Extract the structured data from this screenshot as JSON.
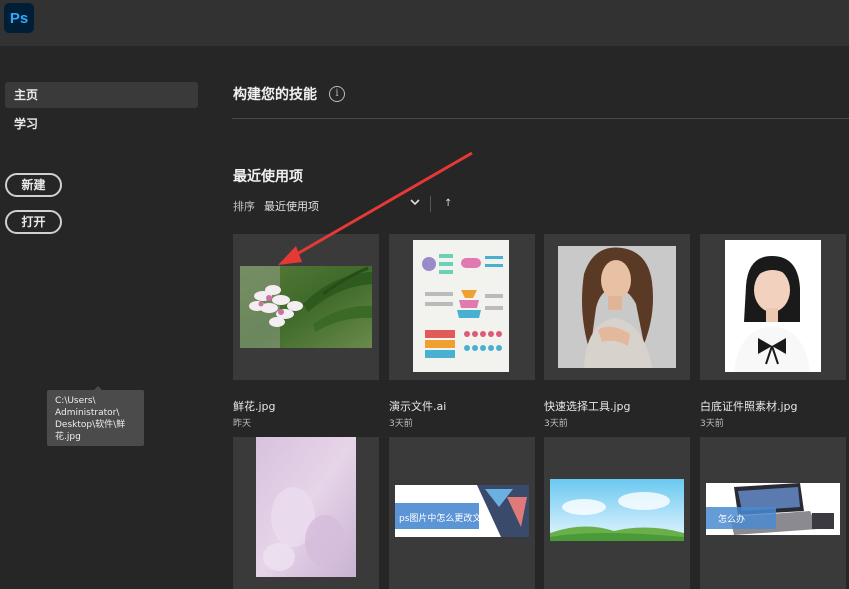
{
  "app": {
    "logo_text": "Ps",
    "accent_color": "#31a8ff"
  },
  "sidebar": {
    "items": [
      {
        "label": "主页",
        "active": true
      },
      {
        "label": "学习",
        "active": false
      }
    ],
    "new_button": "新建",
    "open_button": "打开"
  },
  "main": {
    "skills_title": "构建您的技能",
    "info_icon": "i",
    "recent_title": "最近使用项",
    "sort_label": "排序",
    "sort_value": "最近使用项",
    "sort_direction_icon": "↑"
  },
  "files": [
    {
      "name": "鲜花.jpg",
      "date": "昨天"
    },
    {
      "name": "演示文件.ai",
      "date": "3天前"
    },
    {
      "name": "快速选择工具.jpg",
      "date": "3天前"
    },
    {
      "name": "白底证件照素材.jpg",
      "date": "3天前"
    }
  ],
  "thumb_texts": {
    "file6": "ps图片中怎么更改文字",
    "file8": "怎么办"
  },
  "tooltip": {
    "path": "C:\\Users\\ Administrator\\ Desktop\\软件\\鲜花.jpg"
  },
  "annotation": {
    "arrow_color": "#e53935"
  }
}
